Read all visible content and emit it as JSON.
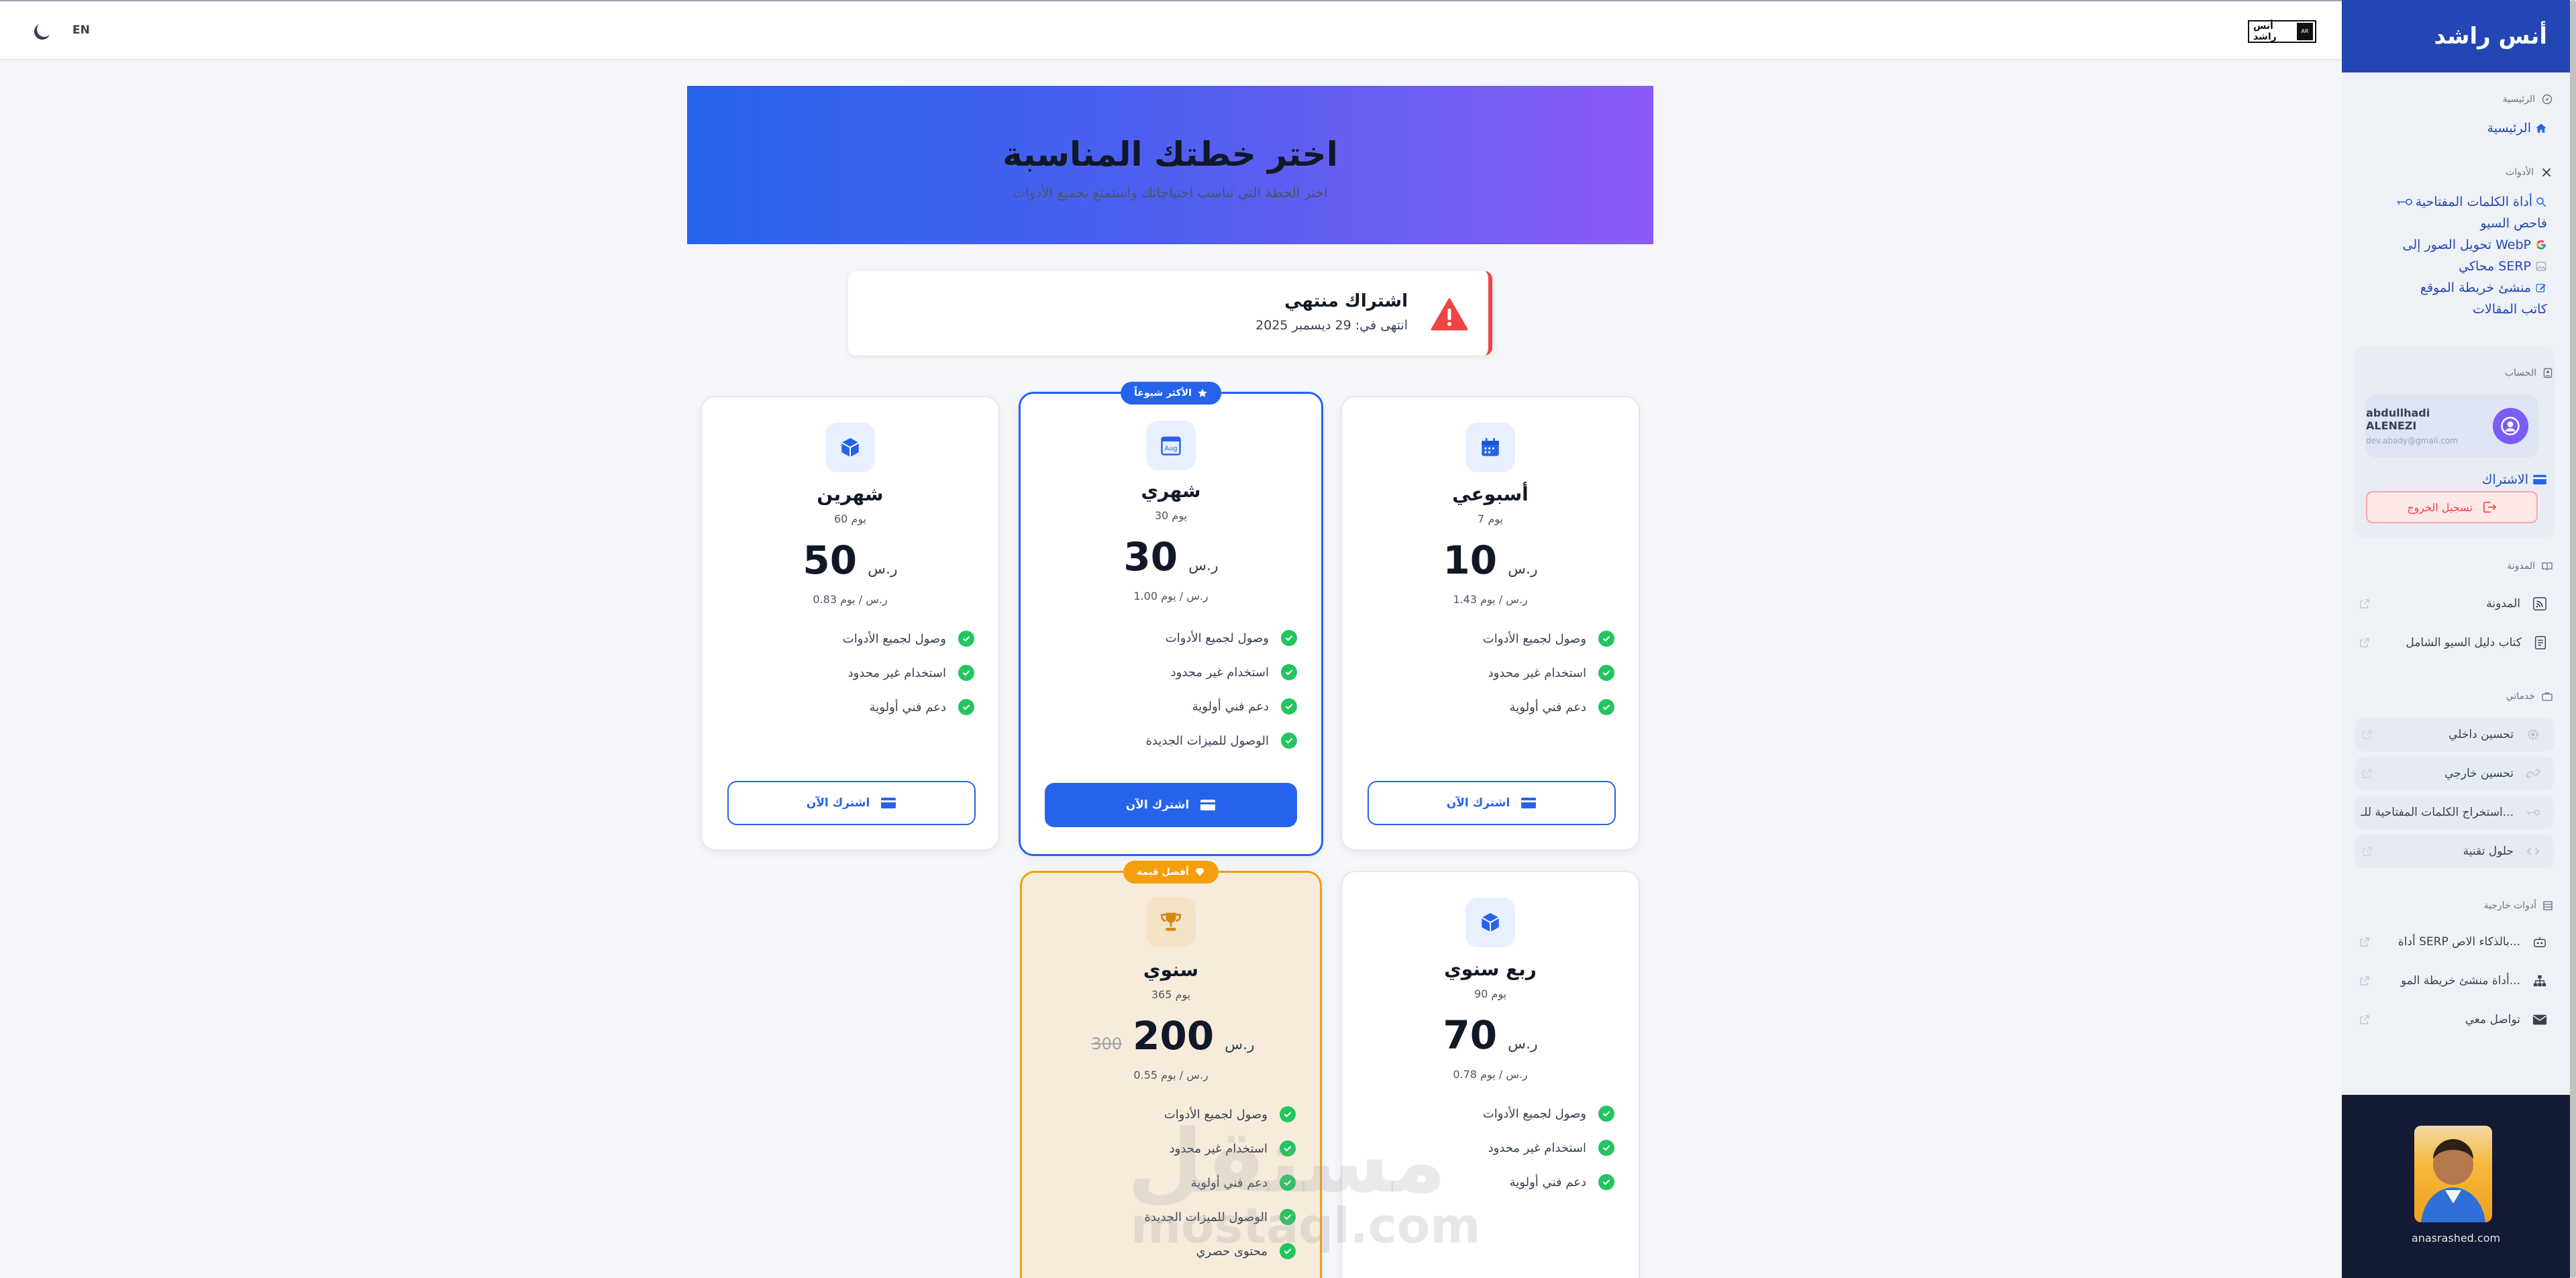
{
  "topbar": {
    "language": "EN",
    "logo_text": "أنس راشد",
    "logo_mark": "AR"
  },
  "sidebar": {
    "brand": "أنس راشد",
    "sections": {
      "home": "الرئيسية",
      "tools": "الأدوات",
      "account": "الحساب",
      "blog": "المدونة",
      "services": "خدماتي",
      "external": "أدوات خارجية"
    },
    "home_link": "الرئيسية",
    "tool_links": [
      "أداة الكلمات المفتاحية",
      "فاحص السيو",
      "تحويل الصور إلى WebP",
      "محاكي SERP",
      "منشئ خريطة الموقع",
      "كاتب المقالات"
    ],
    "user": {
      "name": "abdullhadi ALENEZI",
      "email": "dev.abady@gmail.com"
    },
    "subscription_link": "الاشتراك",
    "logout": "تسجيل الخروج",
    "blog_links": [
      "المدونة",
      "كتاب دليل السيو الشامل"
    ],
    "services": [
      "تحسين داخلي",
      "تحسين خارجي",
      "استخراج الكلمات المفتاحية للـ...",
      "حلول تقنية"
    ],
    "external_tools": [
      "أداة SERP بالذكاء الاص...",
      "أداة منشئ خريطة المو...",
      "تواصل معي"
    ],
    "photo_caption": "anasrashed.com"
  },
  "hero": {
    "title": "اختر خطتك المناسبة",
    "subtitle": "اختر الخطة التي تناسب احتياجاتك واستمتع بجميع الأدوات"
  },
  "alert": {
    "title": "اشتراك منتهي",
    "date": "انتهى في: 29 ديسمبر 2025"
  },
  "currency": "ر.س",
  "plans": [
    {
      "id": "weekly",
      "name": "أسبوعي",
      "days": "7 يوم",
      "price": "10",
      "per_day": "1.43 ر.س / يوم",
      "features": [
        "وصول لجميع الأدوات",
        "استخدام غير محدود",
        "دعم فني أولوية"
      ],
      "button": "اشترك الآن"
    },
    {
      "id": "monthly",
      "name": "شهري",
      "days": "30 يوم",
      "price": "30",
      "per_day": "1.00 ر.س / يوم",
      "badge": "الأكثر شيوعاً",
      "icon_label": "Aug",
      "features": [
        "وصول لجميع الأدوات",
        "استخدام غير محدود",
        "دعم فني أولوية",
        "الوصول للميزات الجديدة"
      ],
      "button": "اشترك الآن"
    },
    {
      "id": "bimonthly",
      "name": "شهرين",
      "days": "60 يوم",
      "price": "50",
      "per_day": "0.83 ر.س / يوم",
      "features": [
        "وصول لجميع الأدوات",
        "استخدام غير محدود",
        "دعم فني أولوية"
      ],
      "button": "اشترك الآن"
    },
    {
      "id": "quarterly",
      "name": "ربع سنوي",
      "days": "90 يوم",
      "price": "70",
      "per_day": "0.78 ر.س / يوم",
      "features": [
        "وصول لجميع الأدوات",
        "استخدام غير محدود",
        "دعم فني أولوية"
      ]
    },
    {
      "id": "yearly",
      "name": "سنوي",
      "days": "365 يوم",
      "price": "200",
      "old_price": "300",
      "per_day": "0.55 ر.س / يوم",
      "badge": "أفضل قيمة",
      "features": [
        "وصول لجميع الأدوات",
        "استخدام غير محدود",
        "دعم فني أولوية",
        "الوصول للميزات الجديدة",
        "محتوى حصري"
      ]
    }
  ],
  "watermark": {
    "line1": "مستقل",
    "line2": "mostaql.com"
  },
  "colors": {
    "primary": "#2563eb",
    "sidebar_header": "#2346b4",
    "danger": "#ef4444",
    "success": "#22c55e",
    "gold": "#f59e0b"
  }
}
